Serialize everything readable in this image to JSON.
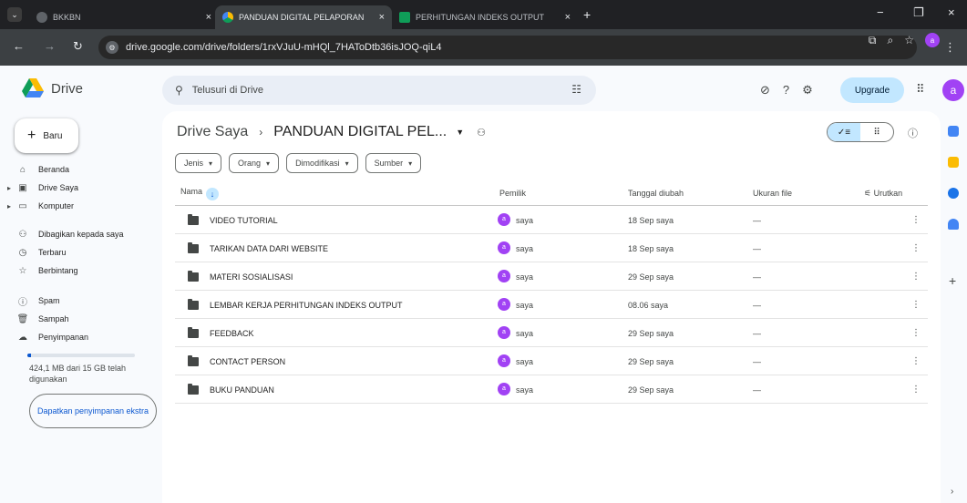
{
  "browser": {
    "tabs": [
      {
        "label": "BKKBN",
        "favicon_color": "#5f6368",
        "active": false
      },
      {
        "label": "PANDUAN DIGITAL PELAPORAN",
        "favicon_color": "#fbbc04",
        "active": true
      },
      {
        "label": "PERHITUNGAN INDEKS OUTPUT",
        "favicon_color": "#0f9d58",
        "active": false
      }
    ],
    "url": "drive.google.com/drive/folders/1rxVJuU-mHQl_7HAToDtb36isJOQ-qiL4"
  },
  "drive": {
    "app_name": "Drive",
    "search_placeholder": "Telusuri di Drive",
    "upgrade_label": "Upgrade",
    "account_initial": "a",
    "accent": "#0b57d0"
  },
  "sidebar": {
    "new_label": "Baru",
    "items": [
      {
        "label": "Beranda",
        "icon": "home-icon"
      },
      {
        "label": "Drive Saya",
        "icon": "my-drive-icon"
      },
      {
        "label": "Komputer",
        "icon": "computer-icon"
      },
      {
        "label": "Dibagikan kepada saya",
        "icon": "shared-icon"
      },
      {
        "label": "Terbaru",
        "icon": "clock-icon"
      },
      {
        "label": "Berbintang",
        "icon": "star-icon"
      },
      {
        "label": "Spam",
        "icon": "spam-icon"
      },
      {
        "label": "Sampah",
        "icon": "trash-icon"
      },
      {
        "label": "Penyimpanan",
        "icon": "cloud-icon"
      }
    ],
    "storage_used_fraction": 0.03,
    "storage_text": "424,1 MB dari 15 GB telah digunakan",
    "get_storage_label": "Dapatkan penyimpanan ekstra"
  },
  "main": {
    "breadcrumb_root": "Drive Saya",
    "breadcrumb_current": "PANDUAN DIGITAL PEL...",
    "filters": [
      "Jenis",
      "Orang",
      "Dimodifikasi",
      "Sumber"
    ],
    "columns": {
      "name": "Nama",
      "owner": "Pemilik",
      "modified": "Tanggal diubah",
      "size": "Ukuran file",
      "sort": "Urutkan"
    },
    "rows": [
      {
        "name": "VIDEO TUTORIAL",
        "owner": "saya",
        "modified": "18 Sep saya",
        "size": "—"
      },
      {
        "name": "TARIKAN DATA DARI WEBSITE",
        "owner": "saya",
        "modified": "18 Sep saya",
        "size": "—"
      },
      {
        "name": "MATERI SOSIALISASI",
        "owner": "saya",
        "modified": "29 Sep saya",
        "size": "—"
      },
      {
        "name": "LEMBAR KERJA PERHITUNGAN INDEKS OUTPUT",
        "owner": "saya",
        "modified": "08.06 saya",
        "size": "—"
      },
      {
        "name": "FEEDBACK",
        "owner": "saya",
        "modified": "29 Sep saya",
        "size": "—"
      },
      {
        "name": "CONTACT PERSON",
        "owner": "saya",
        "modified": "29 Sep saya",
        "size": "—"
      },
      {
        "name": "BUKU PANDUAN",
        "owner": "saya",
        "modified": "29 Sep saya",
        "size": "—"
      }
    ]
  }
}
